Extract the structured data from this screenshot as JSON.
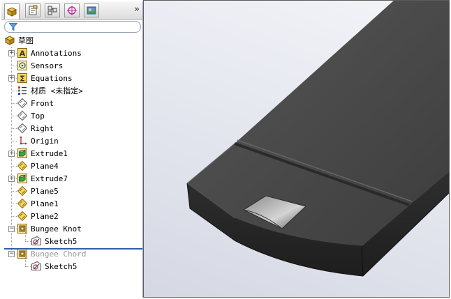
{
  "toolbar": {
    "tabs": [
      {
        "icon": "feature-manager-icon",
        "active": true
      },
      {
        "icon": "property-manager-icon"
      },
      {
        "icon": "configuration-manager-icon"
      },
      {
        "icon": "dimxpert-manager-icon"
      },
      {
        "icon": "display-manager-icon"
      }
    ],
    "overflow": "»"
  },
  "filter": {
    "icon": "filter-icon"
  },
  "tree": {
    "root": {
      "label": "草图",
      "icon": "part-icon"
    },
    "items": [
      {
        "label": "Annotations",
        "icon": "annotations-icon",
        "expandable": true
      },
      {
        "label": "Sensors",
        "icon": "sensors-icon",
        "expandable": false
      },
      {
        "label": "Equations",
        "icon": "equations-icon",
        "expandable": true
      },
      {
        "label": "材质 <未指定>",
        "icon": "material-icon",
        "expandable": false
      },
      {
        "label": "Front",
        "icon": "plane-icon",
        "expandable": false
      },
      {
        "label": "Top",
        "icon": "plane-icon",
        "expandable": false
      },
      {
        "label": "Right",
        "icon": "plane-icon",
        "expandable": false
      },
      {
        "label": "Origin",
        "icon": "origin-icon",
        "expandable": false
      },
      {
        "label": "Extrude1",
        "icon": "extrude-icon",
        "expandable": true
      },
      {
        "label": "Plane4",
        "icon": "ref-plane-icon",
        "expandable": false
      },
      {
        "label": "Extrude7",
        "icon": "extrude-icon",
        "expandable": true
      },
      {
        "label": "Plane5",
        "icon": "ref-plane-icon",
        "expandable": false
      },
      {
        "label": "Plane1",
        "icon": "ref-plane-icon",
        "expandable": false
      },
      {
        "label": "Plane2",
        "icon": "ref-plane-icon",
        "expandable": false
      },
      {
        "label": "Bungee Knot",
        "icon": "cut-icon",
        "expandable": true,
        "expanded": true
      },
      {
        "label": "Sketch5",
        "icon": "sketch-icon",
        "child": true
      },
      {
        "label": "Bungee Chord",
        "icon": "cut-icon",
        "expandable": true,
        "expanded": true,
        "suppressed": true
      },
      {
        "label": "Sketch5",
        "icon": "sketch-icon",
        "child": true
      }
    ]
  },
  "viewport": {
    "model": "3d-part-model",
    "body_color": "#4a4a4a"
  }
}
